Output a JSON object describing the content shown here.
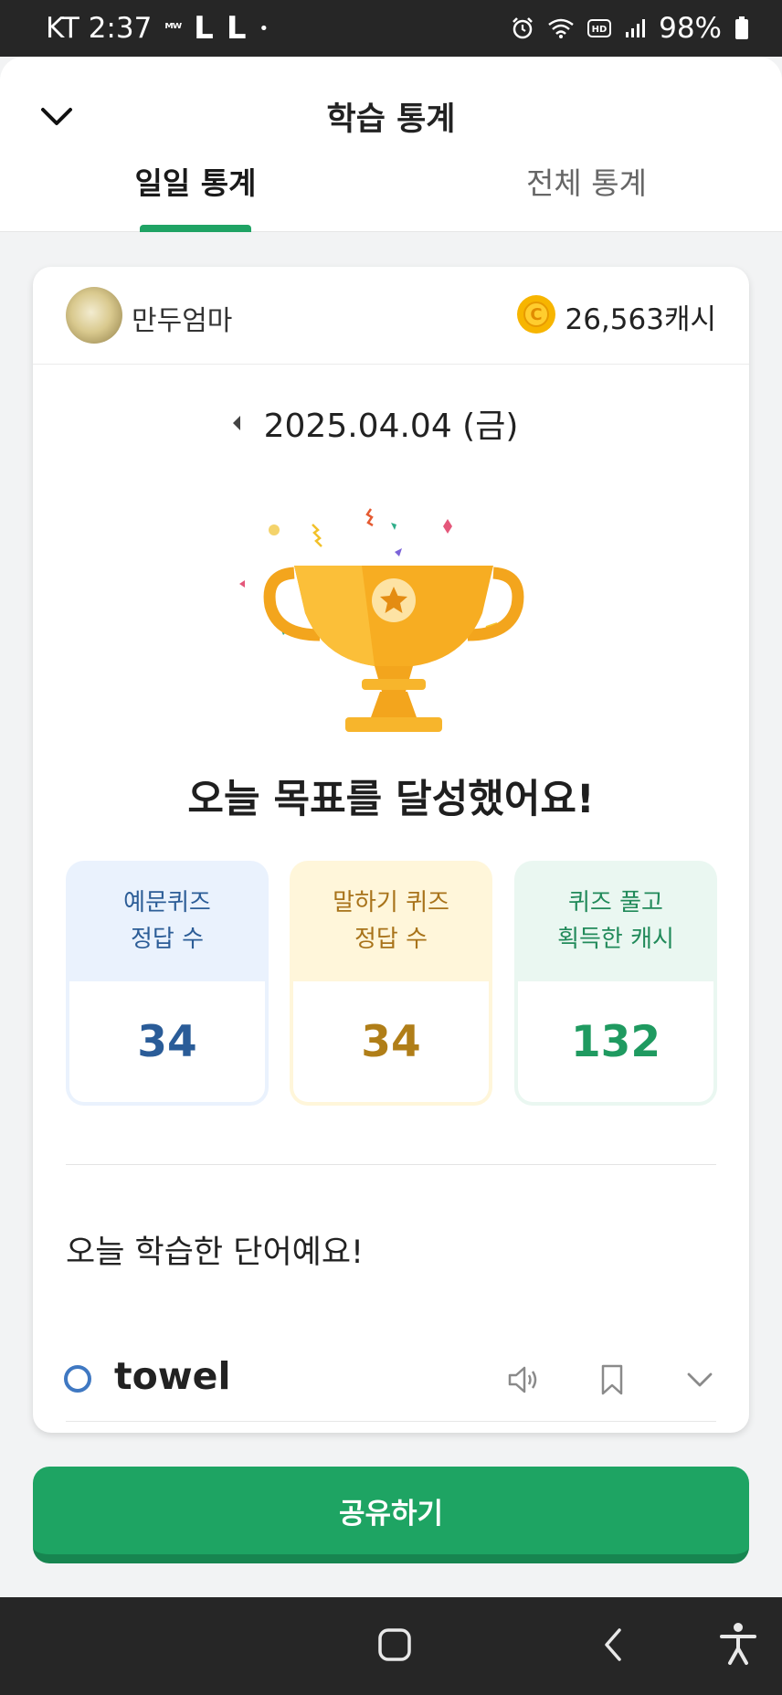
{
  "status_bar": {
    "carrier_time": "KT 2:37",
    "indicator": "ᴹᵂ",
    "l1": "L",
    "l2": "L",
    "dot": "•",
    "battery": "98%"
  },
  "header": {
    "title": "학습 통계",
    "back_icon": "chevron-down-icon",
    "tabs": [
      {
        "label": "일일 통계",
        "active": true
      },
      {
        "label": "전체 통계",
        "active": false
      }
    ],
    "accent": "#1fa364"
  },
  "profile": {
    "name": "만두엄마",
    "coin_symbol": "C",
    "cash": "26,563캐시"
  },
  "date": {
    "text": "2025.04.04 (금)"
  },
  "achievement": "오늘 목표를 달성했어요!",
  "stats": [
    {
      "line1": "예문퀴즈",
      "line2": "정답 수",
      "value": "34"
    },
    {
      "line1": "말하기 퀴즈",
      "line2": "정답 수",
      "value": "34"
    },
    {
      "line1": "퀴즈 풀고",
      "line2": "획득한 캐시",
      "value": "132"
    }
  ],
  "words": {
    "heading": "오늘 학습한 단어예요!",
    "items": [
      {
        "word": "towel"
      }
    ]
  },
  "share_button": "공유하기",
  "nav": [
    "home-icon",
    "back-icon",
    "accessibility-icon"
  ]
}
